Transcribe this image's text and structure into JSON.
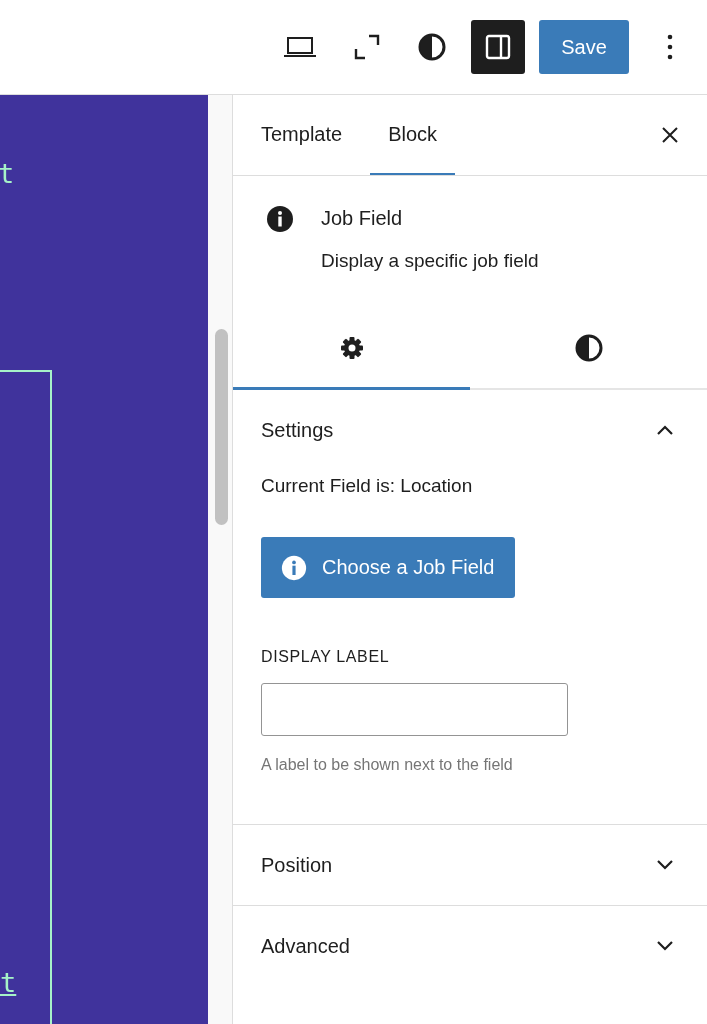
{
  "toolbar": {
    "sidebar_toggle": {
      "pressed": true
    },
    "save": "Save"
  },
  "canvas": {
    "texts": [
      "t",
      "t"
    ]
  },
  "tabs": [
    {
      "label": "Template",
      "selected": false
    },
    {
      "label": "Block",
      "selected": true
    }
  ],
  "block": {
    "title": "Job Field",
    "description": "Display a specific job field"
  },
  "inspector_tabs": [
    {
      "kind": "settings",
      "selected": true
    },
    {
      "kind": "styles",
      "selected": false
    }
  ],
  "panels": [
    {
      "title": "Settings",
      "expanded": true,
      "current_field": "Current Field is: Location",
      "button": "Choose a Job Field",
      "field_label": "DISPLAY LABEL",
      "help": "A label to be shown next to the field"
    },
    {
      "title": "Position",
      "expanded": false
    },
    {
      "title": "Advanced",
      "expanded": false
    }
  ]
}
